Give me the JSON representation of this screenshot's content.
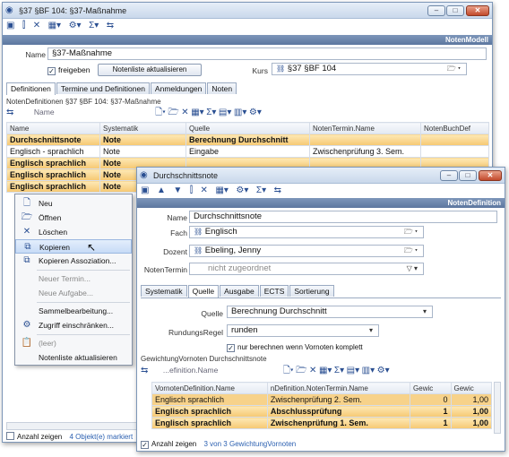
{
  "main": {
    "title": "§37 §BF 104: §37-Maßnahme",
    "band": "NotenModell",
    "name_label": "Name",
    "name_value": "§37-Maßnahme",
    "freigeben_label": "freigeben",
    "notenliste_btn": "Notenliste aktualisieren",
    "kurs_label": "Kurs",
    "kurs_value": "§37 §BF 104",
    "tabs": [
      "Definitionen",
      "Termine und Definitionen",
      "Anmeldungen",
      "Noten"
    ],
    "subheader": "NotenDefinitionen §37 §BF 104: §37-Maßnahme",
    "filter_name": "Name",
    "columns": [
      "Name",
      "Systematik",
      "Quelle",
      "NotenTermin.Name",
      "NotenBuchDef"
    ],
    "rows": [
      [
        "Durchschnittsnote",
        "Note",
        "Berechnung Durchschnitt",
        "",
        ""
      ],
      [
        "Englisch - sprachlich",
        "Note",
        "Eingabe",
        "Zwischenprüfung 3. Sem.",
        ""
      ],
      [
        "Englisch sprachlich",
        "Note",
        "",
        "",
        ""
      ],
      [
        "Englisch sprachlich",
        "Note",
        "",
        "",
        ""
      ],
      [
        "Englisch sprachlich",
        "Note",
        "",
        "",
        ""
      ]
    ],
    "status_label": "Anzahl zeigen",
    "status_count": "4 Objekt(e) markiert"
  },
  "context_menu": {
    "items": [
      {
        "label": "Neu",
        "icon": "new-document-icon",
        "glyph": "🗋"
      },
      {
        "label": "Öffnen",
        "icon": "open-folder-icon",
        "glyph": "🗁"
      },
      {
        "label": "Löschen",
        "icon": "delete-x-icon",
        "glyph": "✕"
      },
      {
        "label": "Kopieren",
        "icon": "copy-icon",
        "glyph": "⧉"
      },
      {
        "label": "Kopieren Assoziation...",
        "icon": "copy-association-icon",
        "glyph": "⧉"
      },
      {
        "label": "Neuer Termin...",
        "icon": "",
        "glyph": ""
      },
      {
        "label": "Neue Aufgabe...",
        "icon": "",
        "glyph": ""
      },
      {
        "label": "Sammelbearbeitung...",
        "icon": "",
        "glyph": ""
      },
      {
        "label": "Zugriff einschränken...",
        "icon": "access-restrict-icon",
        "glyph": "⚙"
      },
      {
        "label": "(leer)",
        "icon": "clipboard-icon",
        "glyph": "📋"
      },
      {
        "label": "Notenliste aktualisieren",
        "icon": "",
        "glyph": ""
      }
    ]
  },
  "detail": {
    "title": "Durchschnittsnote",
    "band": "NotenDefinition",
    "name_label": "Name",
    "name_value": "Durchschnittsnote",
    "fach_label": "Fach",
    "fach_value": "Englisch",
    "dozent_label": "Dozent",
    "dozent_value": "Ebeling, Jenny",
    "termin_label": "NotenTermin",
    "termin_value": "nicht zugeordnet",
    "tabs": [
      "Systematik",
      "Quelle",
      "Ausgabe",
      "ECTS",
      "Sortierung"
    ],
    "quelle_label": "Quelle",
    "quelle_value": "Berechnung Durchschnitt",
    "rundung_label": "RundungsRegel",
    "rundung_value": "runden",
    "nur_label": "nur berechnen wenn Vornoten komplett",
    "subheader": "GewichtungVornoten Durchschnittsnote",
    "filter_name": "...efinition.Name",
    "columns": [
      "VornotenDefinition.Name",
      "nDefinition.NotenTermin.Name",
      "Gewic",
      "Gewic"
    ],
    "rows": [
      [
        "Englisch sprachlich",
        "Zwischenprüfung 2. Sem.",
        "0",
        "1,00"
      ],
      [
        "Englisch sprachlich",
        "Abschlussprüfung",
        "1",
        "1,00"
      ],
      [
        "Englisch sprachlich",
        "Zwischenprüfung 1. Sem.",
        "1",
        "1,00"
      ]
    ],
    "status_label": "Anzahl zeigen",
    "status_count": "3 von 3 GewichtungVornoten"
  }
}
